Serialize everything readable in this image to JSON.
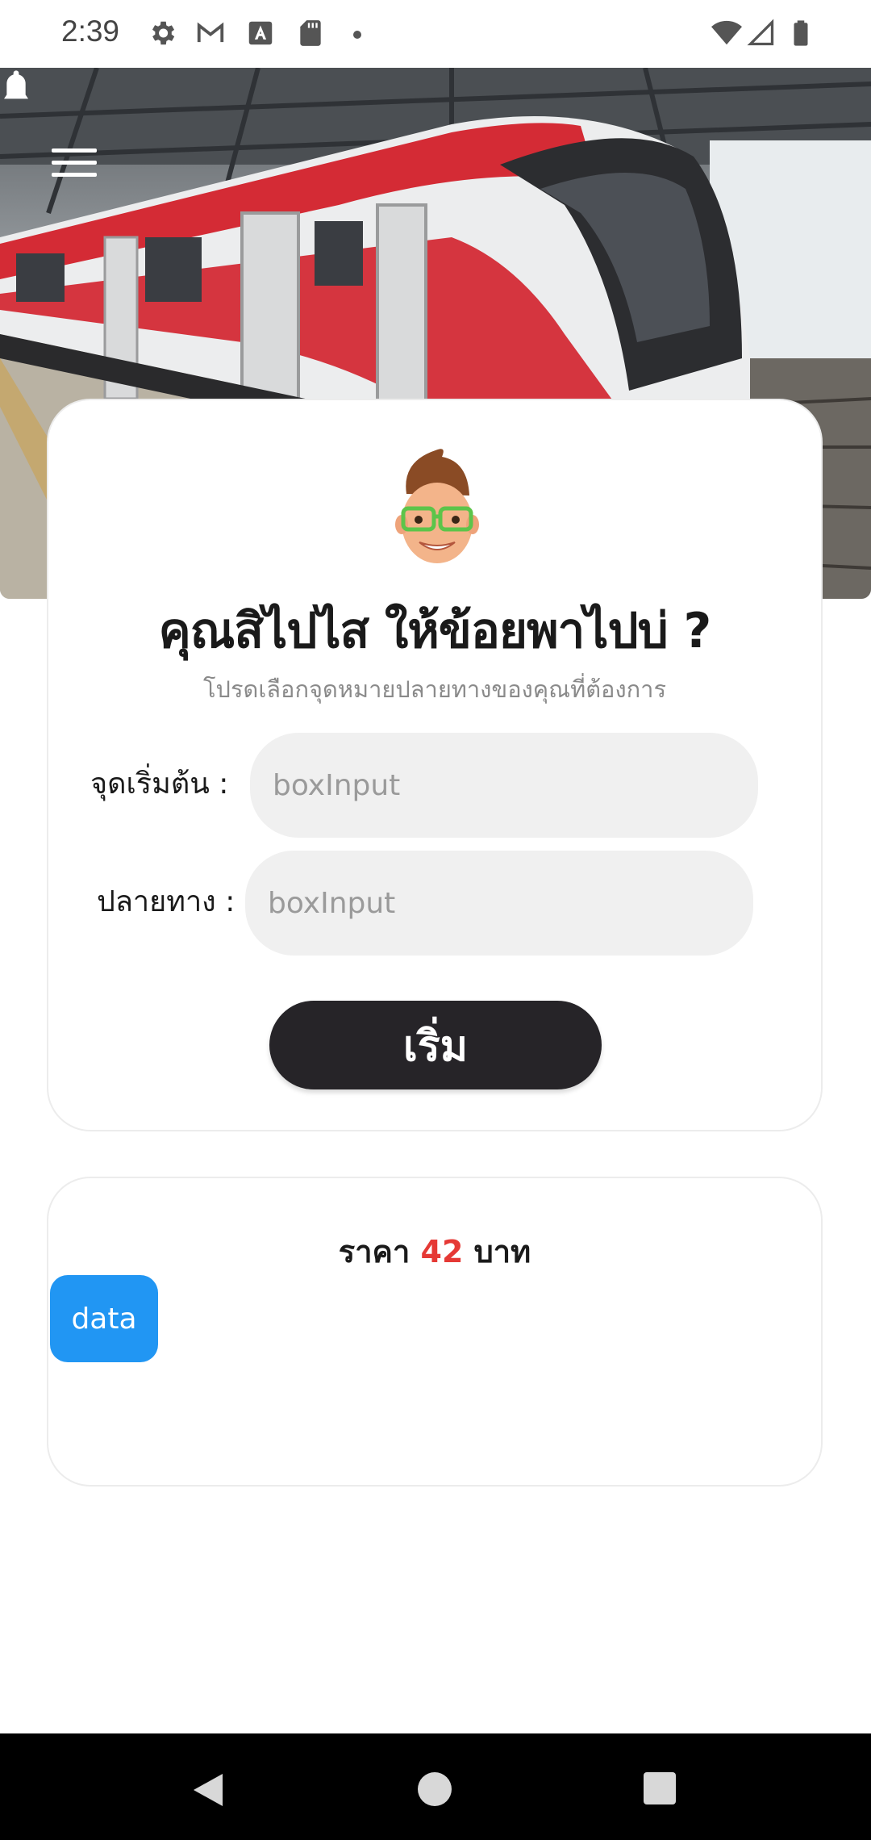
{
  "status_bar": {
    "time": "2:39",
    "left_icons": [
      "gear-icon",
      "gmail-icon",
      "font-icon",
      "sd-card-icon",
      "dot-icon"
    ],
    "right_icons": [
      "wifi-icon",
      "signal-icon",
      "battery-icon"
    ]
  },
  "hero": {
    "image": "red-white-train-at-station",
    "menu_icon": "hamburger-menu-icon",
    "notification_icon": "bell-icon"
  },
  "search_card": {
    "title": "คุณสิไปไส ให้ข้อยพาไปบ่ ?",
    "subtitle": "โปรดเลือกจุดหมายปลายทางของคุณที่ต้องการ",
    "origin_label": "จุดเริ่มต้น :",
    "origin_placeholder": "boxInput",
    "origin_value": "",
    "destination_label": "ปลายทาง :",
    "destination_placeholder": "boxInput",
    "destination_value": "",
    "start_button": "เริ่ม"
  },
  "price_card": {
    "price_prefix": "ราคา",
    "price_value": "42",
    "price_suffix": "บาท",
    "data_button": "data"
  },
  "colors": {
    "primary_dark": "#262428",
    "price_red": "#e53935",
    "data_blue": "#2196f3",
    "input_bg": "#f0f0f0"
  }
}
